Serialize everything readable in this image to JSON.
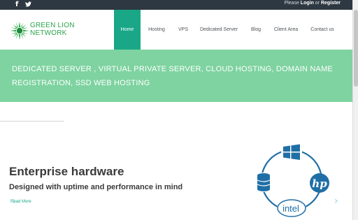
{
  "topbar": {
    "facebook_glyph": "f",
    "twitter_glyph": "t",
    "auth": {
      "prefix": "Please ",
      "login": "Login",
      "or": " or ",
      "register": "Register"
    }
  },
  "logo": {
    "line1": "GREEN LION",
    "line2": "NETWORK"
  },
  "nav": {
    "items": [
      {
        "label": "Home",
        "active": true
      },
      {
        "label": "Hosting"
      },
      {
        "label": "VPS"
      },
      {
        "label": "Dedicated Server"
      },
      {
        "label": "Blog"
      },
      {
        "label": "Client Area"
      },
      {
        "label": "Contact us"
      }
    ]
  },
  "banner": {
    "text": "DEDICATED SERVER , VIRTUAL PRIVATE SERVER, CLOUD HOSTING, DOMAIN NAME REGISTRATION, SSD WEB HOSTING"
  },
  "hero": {
    "title": "Enterprise hardware",
    "subtitle": "Designed with uptime and performance in mind",
    "read_more": "Read More",
    "prev_glyph": "‹",
    "next_glyph": "›",
    "diagram": {
      "hp_label": "hp",
      "intel_label": "intel"
    }
  },
  "colors": {
    "topbar": "#2e3842",
    "accent": "#19a787",
    "banner": "#7ed3a0",
    "diagram_blue": "#1f6fa6"
  }
}
